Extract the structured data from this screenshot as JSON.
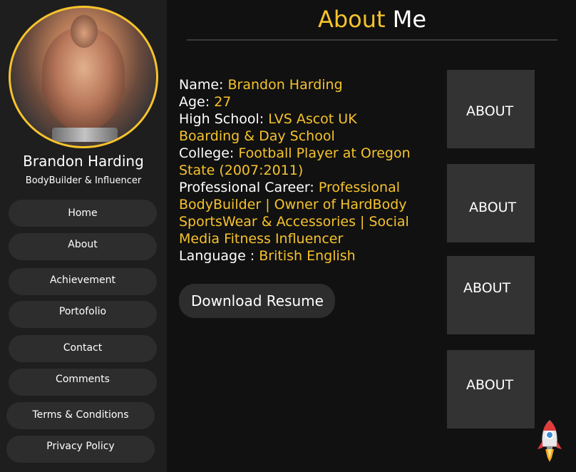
{
  "profile": {
    "name": "Brandon Harding",
    "title": "BodyBuilder & Influencer"
  },
  "nav": {
    "items": [
      {
        "label": "Home"
      },
      {
        "label": "About"
      },
      {
        "label": "Achievement"
      },
      {
        "label": "Portofolio"
      },
      {
        "label": "Contact"
      },
      {
        "label": "Comments"
      },
      {
        "label": "Terms & Conditions"
      },
      {
        "label": "Privacy Policy"
      }
    ]
  },
  "page": {
    "title_accent": "About",
    "title_rest": " Me"
  },
  "info": {
    "name_label": "Name: ",
    "name_value": "Brandon Harding",
    "age_label": "Age: ",
    "age_value": "27",
    "school_label": "High School: ",
    "school_value": "LVS Ascot UK Boarding & Day School",
    "college_label": "College: ",
    "college_value": "Football Player at Oregon State (2007:2011)",
    "career_label": "Professional Career: ",
    "career_value": "Professional BodyBuilder | Owner of HardBody SportsWear & Accessories | Social Media Fitness Influencer",
    "language_label": "Language : ",
    "language_value": "British English"
  },
  "actions": {
    "download_resume": "Download Resume"
  },
  "cards": [
    {
      "label": "ABOUT"
    },
    {
      "label": "ABOUT"
    },
    {
      "label": "ABOUT"
    },
    {
      "label": "ABOUT"
    }
  ],
  "colors": {
    "accent": "#f6c32c",
    "background": "#111111",
    "sidebar": "#1e1e1e",
    "button": "#2d2d2d",
    "card": "#333333"
  },
  "icons": {
    "scroll_top": "rocket-icon"
  }
}
